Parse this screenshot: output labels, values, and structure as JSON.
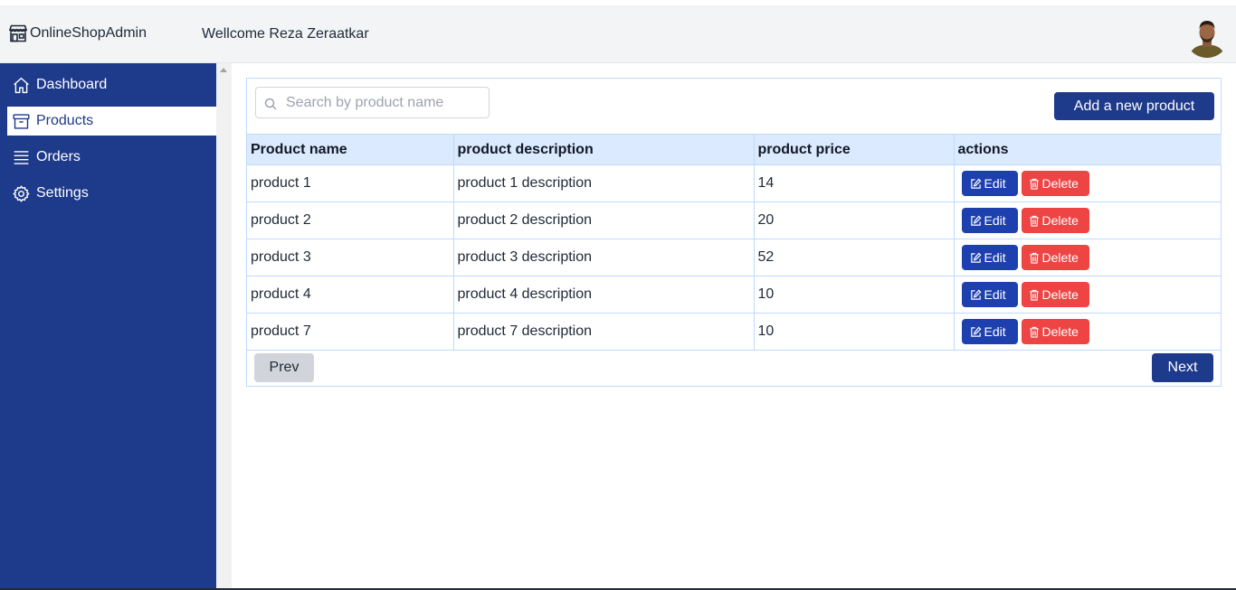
{
  "header": {
    "brand": "OnlineShopAdmin",
    "welcome": "Wellcome Reza Zeraatkar"
  },
  "sidebar": {
    "items": [
      {
        "label": "Dashboard",
        "icon": "home-icon",
        "active": false
      },
      {
        "label": "Products",
        "icon": "archive-box-icon",
        "active": true
      },
      {
        "label": "Orders",
        "icon": "list-icon",
        "active": false
      },
      {
        "label": "Settings",
        "icon": "gear-icon",
        "active": false
      }
    ]
  },
  "toolbar": {
    "search_placeholder": "Search by product name",
    "search_value": "",
    "add_label": "Add a new product"
  },
  "table": {
    "columns": [
      "Product name",
      "product description",
      "product price",
      "actions"
    ],
    "rows": [
      {
        "name": "product 1",
        "description": "product 1 description",
        "price": "14"
      },
      {
        "name": "product 2",
        "description": "product 2 description",
        "price": "20"
      },
      {
        "name": "product 3",
        "description": "product 3 description",
        "price": "52"
      },
      {
        "name": "product 4",
        "description": "product 4 description",
        "price": "10"
      },
      {
        "name": "product 7",
        "description": "product 7 description",
        "price": "10"
      }
    ],
    "edit_label": "Edit",
    "delete_label": "Delete"
  },
  "pagination": {
    "prev_label": "Prev",
    "next_label": "Next"
  },
  "colors": {
    "primary": "#1e3a8a",
    "danger": "#ef4444",
    "table_header": "#dbeafe"
  }
}
